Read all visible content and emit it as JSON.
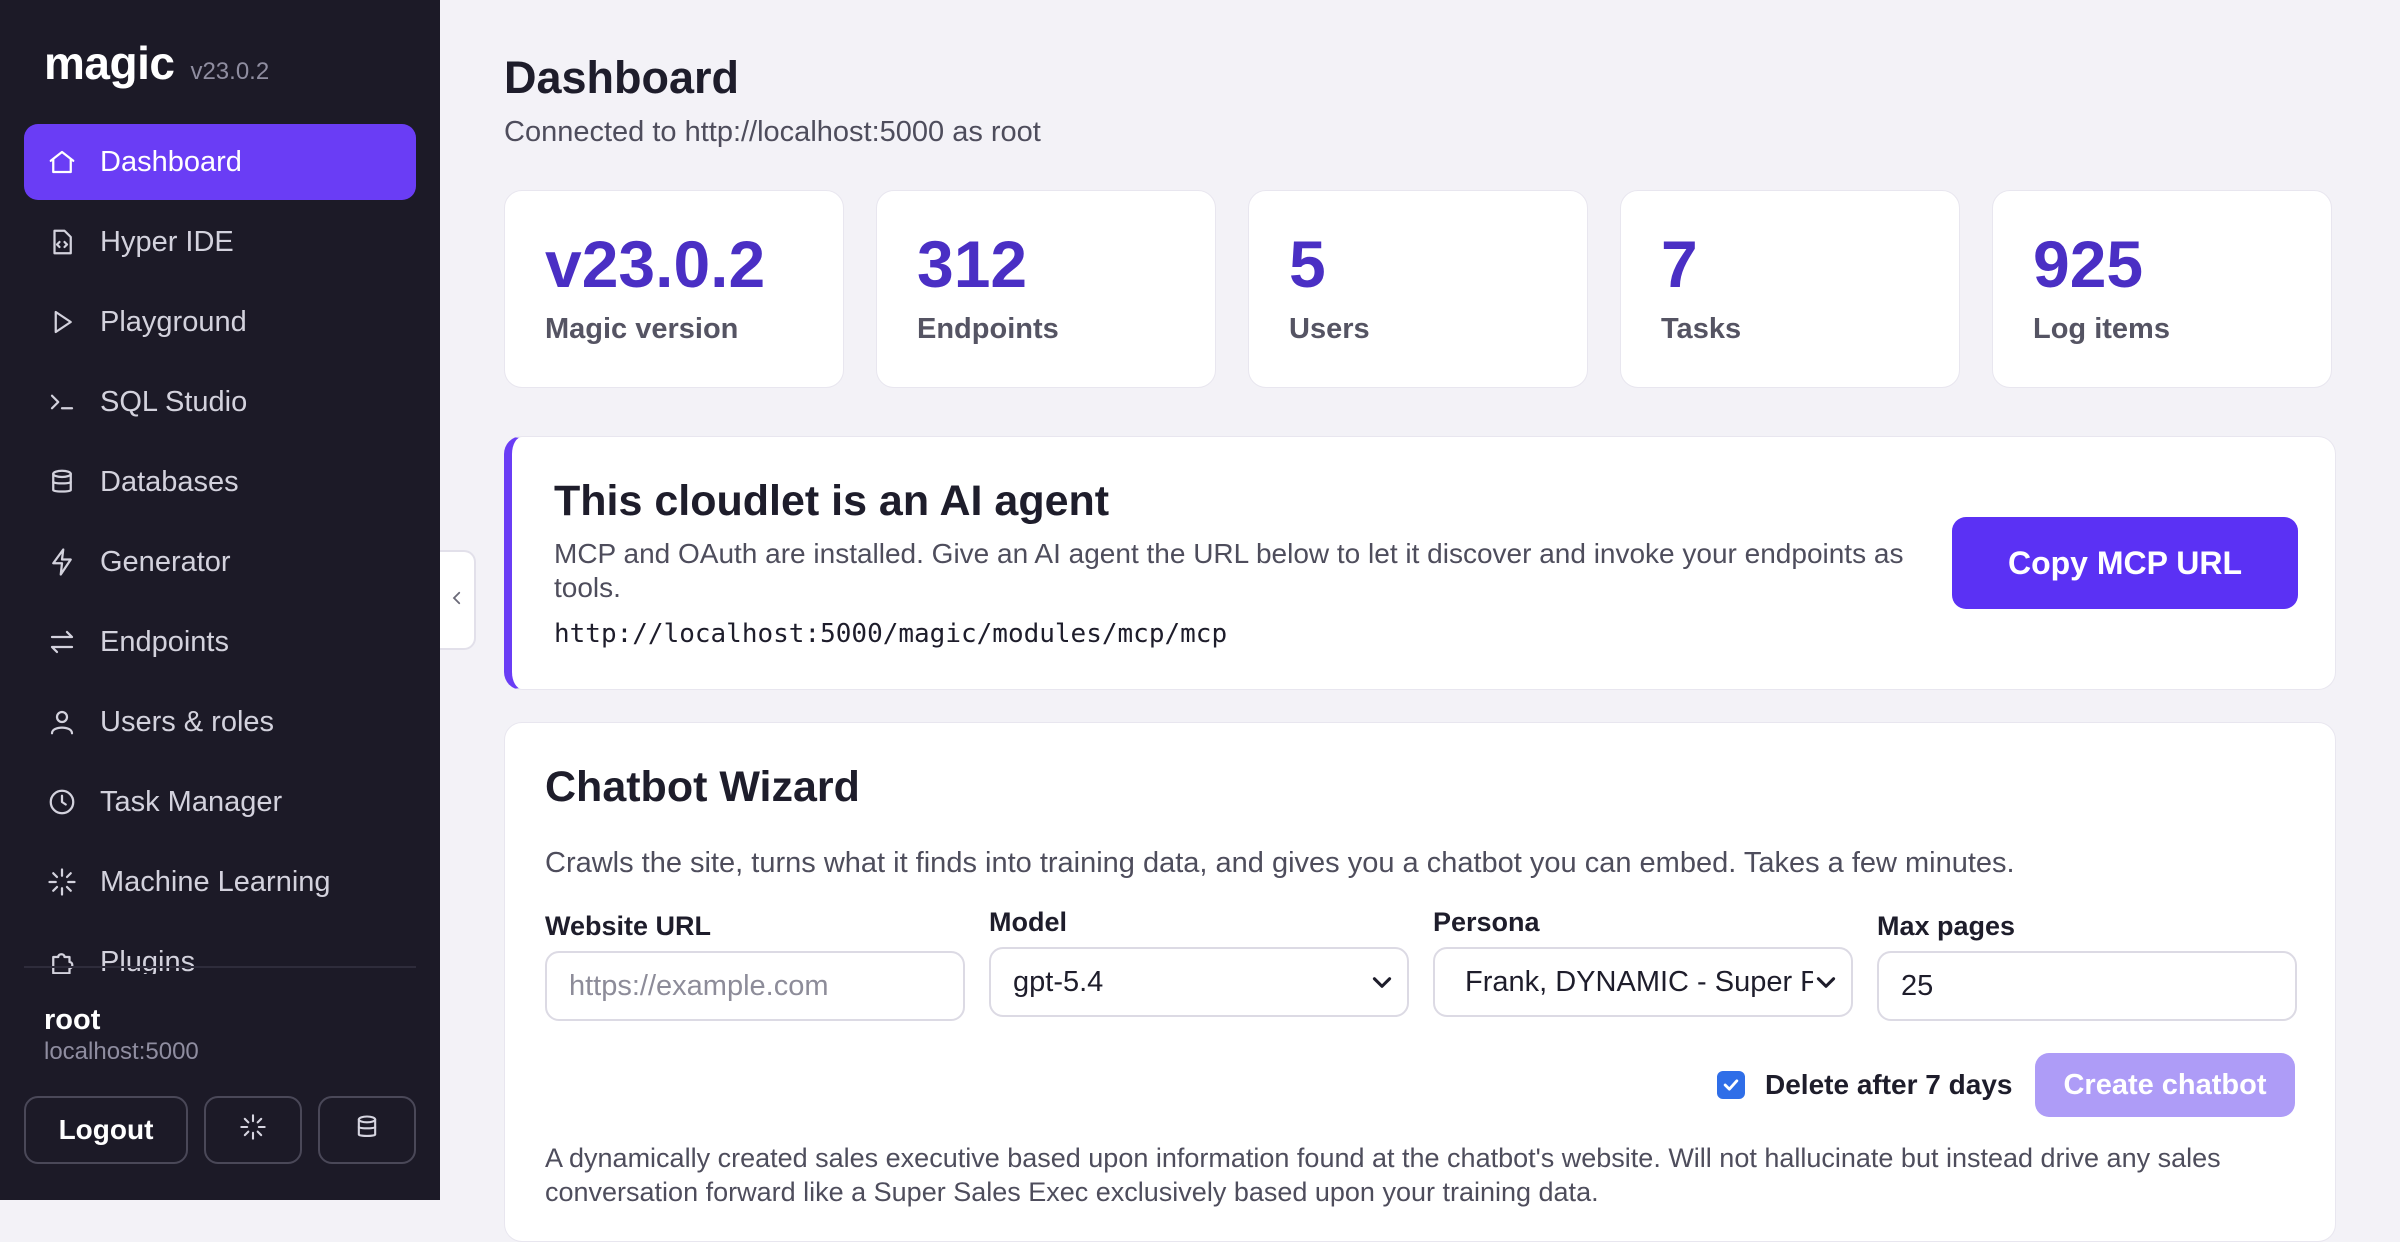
{
  "app": {
    "name": "magic",
    "version": "v23.0.2"
  },
  "sidebar": {
    "items": [
      {
        "label": "Dashboard",
        "icon": "home-icon",
        "active": true
      },
      {
        "label": "Hyper IDE",
        "icon": "code-file-icon"
      },
      {
        "label": "Playground",
        "icon": "play-icon"
      },
      {
        "label": "SQL Studio",
        "icon": "terminal-icon"
      },
      {
        "label": "Databases",
        "icon": "database-icon"
      },
      {
        "label": "Generator",
        "icon": "lightning-icon"
      },
      {
        "label": "Endpoints",
        "icon": "arrows-icon"
      },
      {
        "label": "Users & roles",
        "icon": "user-icon"
      },
      {
        "label": "Task Manager",
        "icon": "clock-icon"
      },
      {
        "label": "Machine Learning",
        "icon": "sparkle-icon"
      },
      {
        "label": "Plugins",
        "icon": "puzzle-icon"
      }
    ],
    "user": {
      "name": "root",
      "host": "localhost:5000"
    },
    "logout_label": "Logout"
  },
  "header": {
    "title": "Dashboard",
    "subtitle": "Connected to http://localhost:5000 as root"
  },
  "stats": [
    {
      "value": "v23.0.2",
      "label": "Magic version"
    },
    {
      "value": "312",
      "label": "Endpoints"
    },
    {
      "value": "5",
      "label": "Users"
    },
    {
      "value": "7",
      "label": "Tasks"
    },
    {
      "value": "925",
      "label": "Log items"
    }
  ],
  "agent": {
    "title": "This cloudlet is an AI agent",
    "description": "MCP and OAuth are installed. Give an AI agent the URL below to let it discover and invoke your endpoints as tools.",
    "url": "http://localhost:5000/magic/modules/mcp/mcp",
    "copy_label": "Copy MCP URL"
  },
  "wizard": {
    "title": "Chatbot Wizard",
    "description": "Crawls the site, turns what it finds into training data, and gives you a chatbot you can embed. Takes a few minutes.",
    "website": {
      "label": "Website URL",
      "placeholder": "https://example.com"
    },
    "model": {
      "label": "Model",
      "value": "gpt-5.4"
    },
    "persona": {
      "label": "Persona",
      "value": "Frank, DYNAMIC - Super Pro"
    },
    "max_pages": {
      "label": "Max pages",
      "value": "25"
    },
    "delete_label": "Delete after 7 days",
    "delete_checked": true,
    "create_label": "Create chatbot",
    "persona_description": "A dynamically created sales executive based upon information found at the chatbot's website. Will not hallucinate but instead drive any sales conversation forward like a Super Sales Exec exclusively based upon your training data."
  },
  "colors": {
    "accent": "#6a3df5",
    "sidebar_bg": "#1c1a27",
    "stat_value": "#4a2fc4",
    "disabled_button": "#ae9cf7"
  }
}
